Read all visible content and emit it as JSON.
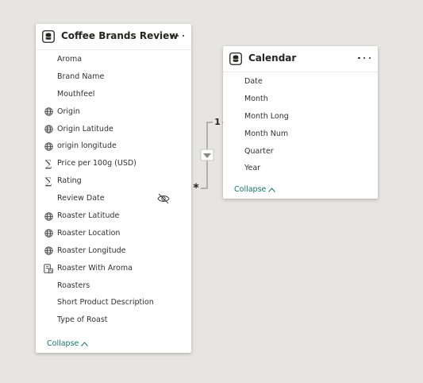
{
  "tables": [
    {
      "title": "Coffee Brands Review",
      "icon": "database-icon",
      "more_icon": "more-options-icon",
      "fields": [
        {
          "label": "Aroma",
          "icon": ""
        },
        {
          "label": "Brand Name",
          "icon": ""
        },
        {
          "label": "Mouthfeel",
          "icon": ""
        },
        {
          "label": "Origin",
          "icon": "globe-icon"
        },
        {
          "label": "Origin Latitude",
          "icon": "globe-icon"
        },
        {
          "label": "origin longitude",
          "icon": "globe-icon"
        },
        {
          "label": "Price per 100g (USD)",
          "icon": "sigma-icon"
        },
        {
          "label": "Rating",
          "icon": "sigma-icon"
        },
        {
          "label": "Review Date",
          "icon": "",
          "hidden_icon": "hidden-eye-icon"
        },
        {
          "label": "Roaster Latitude",
          "icon": "globe-icon"
        },
        {
          "label": "Roaster Location",
          "icon": "globe-icon"
        },
        {
          "label": "Roaster Longitude",
          "icon": "globe-icon"
        },
        {
          "label": "Roaster With Aroma",
          "icon": "calculated-column-icon"
        },
        {
          "label": "Roasters",
          "icon": ""
        },
        {
          "label": "Short Product Description",
          "icon": ""
        },
        {
          "label": "Type of Roast",
          "icon": ""
        }
      ],
      "collapse_label": "Collapse"
    },
    {
      "title": "Calendar",
      "icon": "database-icon",
      "more_icon": "more-options-icon",
      "fields": [
        {
          "label": "Date",
          "icon": ""
        },
        {
          "label": "Month",
          "icon": ""
        },
        {
          "label": "Month Long",
          "icon": ""
        },
        {
          "label": "Month Num",
          "icon": ""
        },
        {
          "label": "Quarter",
          "icon": ""
        },
        {
          "label": "Year",
          "icon": ""
        }
      ],
      "collapse_label": "Collapse"
    }
  ],
  "relationship": {
    "one_side_label": "1",
    "many_side_label": "*",
    "filter_direction_icon": "filter-direction-arrow-icon"
  },
  "colors": {
    "canvas": "#e6e5e3",
    "card": "#ffffff",
    "text": "#252423",
    "collapse_link": "#117865",
    "line": "#a19f9d"
  }
}
